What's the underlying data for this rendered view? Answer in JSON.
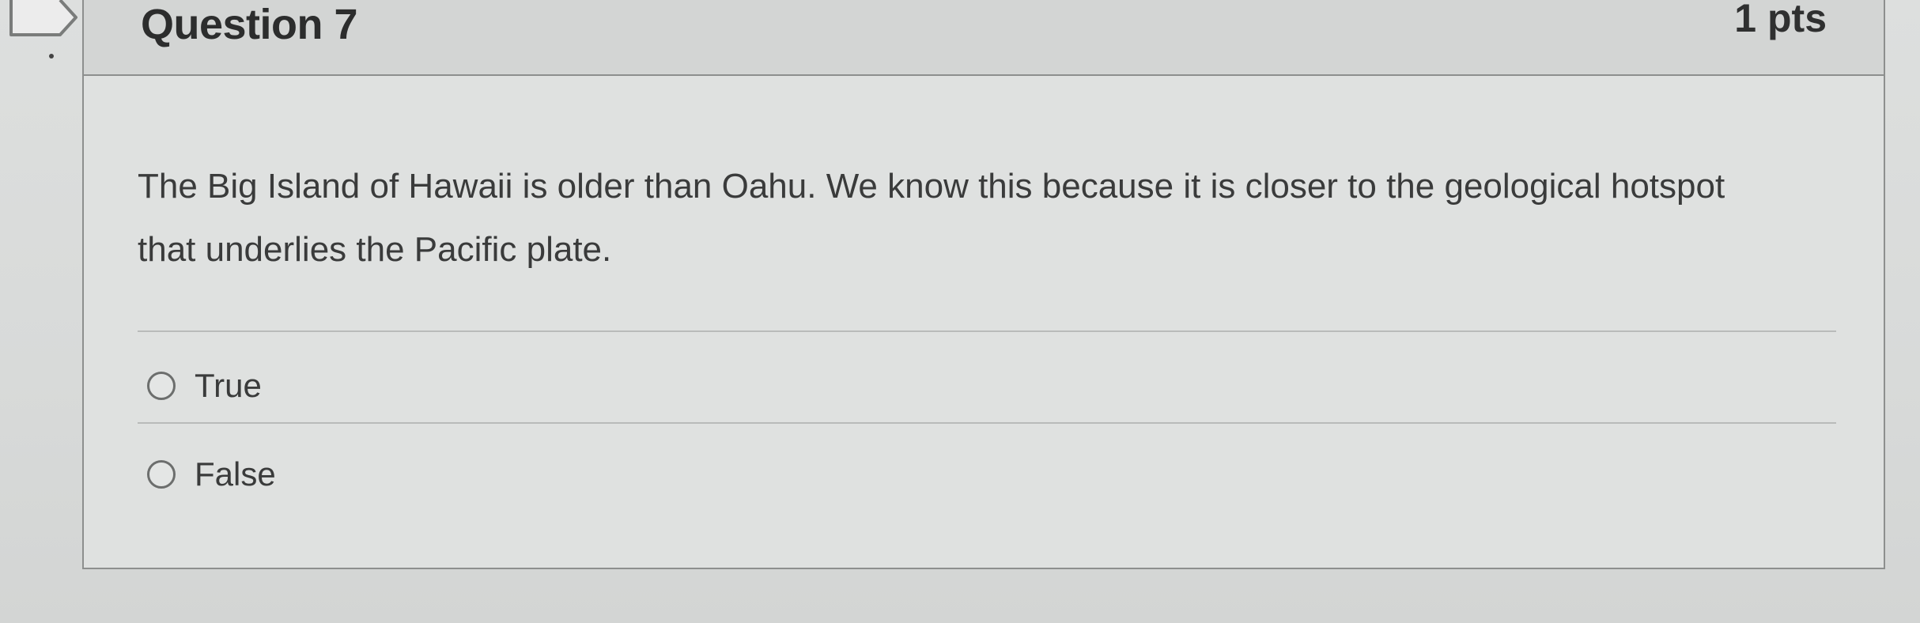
{
  "question": {
    "title": "Question 7",
    "points": "1 pts",
    "text": "The Big Island of Hawaii is older than Oahu.  We know this because it is closer to the geological hotspot that underlies the Pacific plate.",
    "answers": [
      {
        "label": "True",
        "selected": false
      },
      {
        "label": "False",
        "selected": false
      }
    ]
  },
  "icons": {
    "flag": "flag-bookmark-icon",
    "radio": "radio-unchecked-icon"
  },
  "colors": {
    "border": "#8d8f8e",
    "text": "#3a3b3b",
    "header_bg": "#d3d5d4"
  }
}
